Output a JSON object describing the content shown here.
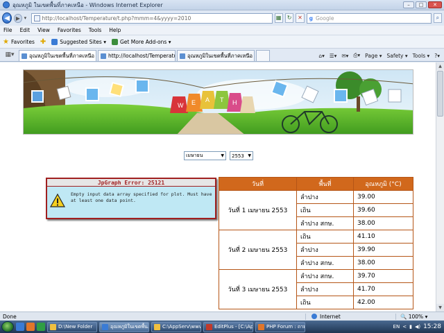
{
  "window": {
    "title": "อุณหภูมิ ในเขตพื้นที่ภาคเหนือ - Windows Internet Explorer",
    "controls": [
      "–",
      "□",
      "✕"
    ]
  },
  "address": {
    "url": "http://localhost/Temperature/t.php?mmm=4&yyyy=2010",
    "search_placeholder": "Google"
  },
  "menu": [
    "File",
    "Edit",
    "View",
    "Favorites",
    "Tools",
    "Help"
  ],
  "favorites": {
    "label": "Favorites",
    "items": [
      "Suggested Sites ▾",
      "Get More Add-ons ▾"
    ]
  },
  "tabs": [
    {
      "label": "อุณหภูมิในเขตพื้นที่ภาคเหนือ",
      "active": true
    },
    {
      "label": "http://localhost/Temperature...",
      "active": false
    },
    {
      "label": "อุณหภูมิในเขตพื้นที่ภาคเหนือ",
      "active": false
    }
  ],
  "tab_tools": [
    "Page ▾",
    "Safety ▾",
    "Tools ▾",
    "?▾"
  ],
  "banner": {
    "sign_letters": [
      "W",
      "E",
      "A",
      "T",
      "H"
    ]
  },
  "filters": {
    "month": "เมษายน",
    "year": "2553"
  },
  "error": {
    "title": "JpGraph Error: 25121",
    "message": "Empty input data array specified for plot. Must have at least one data point."
  },
  "table": {
    "headers": [
      "วันที่",
      "พื้นที่",
      "อุณหภูมิ (°C)"
    ],
    "groups": [
      {
        "date": "วันที่ 1 เมษายน 2553",
        "rows": [
          {
            "area": "ลำปาง",
            "temp": "39.00"
          },
          {
            "area": "เถิน",
            "temp": "39.60"
          },
          {
            "area": "ลำปาง สกษ.",
            "temp": "38.00"
          }
        ]
      },
      {
        "date": "วันที่ 2 เมษายน 2553",
        "rows": [
          {
            "area": "เถิน",
            "temp": "41.10"
          },
          {
            "area": "ลำปาง",
            "temp": "39.90"
          },
          {
            "area": "ลำปาง สกษ.",
            "temp": "38.00"
          }
        ]
      },
      {
        "date": "วันที่ 3 เมษายน 2553",
        "rows": [
          {
            "area": "ลำปาง สกษ.",
            "temp": "39.70"
          },
          {
            "area": "ลำปาง",
            "temp": "41.70"
          },
          {
            "area": "เถิน",
            "temp": "42.00"
          }
        ]
      }
    ]
  },
  "status": {
    "text": "Done",
    "zone": "Internet",
    "zoom": "100%"
  },
  "taskbar": {
    "buttons": [
      {
        "label": "D:\\New Folder",
        "active": false
      },
      {
        "label": "อุณหภูมิในเขตพื้น...",
        "active": true
      },
      {
        "label": "C:\\AppServ\\www...",
        "active": false
      },
      {
        "label": "EditPlus - [C:\\App...",
        "active": false
      },
      {
        "label": "PHP Forum : ถาม-...",
        "active": false
      }
    ],
    "tray": [
      "EN",
      "<"
    ],
    "clock": "15:28"
  }
}
